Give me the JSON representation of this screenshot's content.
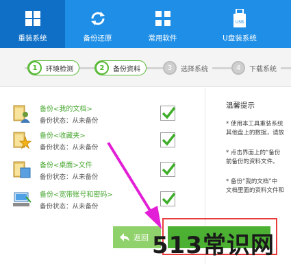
{
  "nav": {
    "items": [
      {
        "label": "重装系统",
        "icon": "windows-icon",
        "active": true
      },
      {
        "label": "备份还原",
        "icon": "refresh-icon",
        "active": false
      },
      {
        "label": "常用软件",
        "icon": "apps-icon",
        "active": false
      },
      {
        "label": "U盘装系统",
        "icon": "usb-icon",
        "active": false
      }
    ],
    "usb_text": "USB"
  },
  "steps": [
    {
      "num": "1",
      "label": "环境检测",
      "state": "done"
    },
    {
      "num": "2",
      "label": "备份资料",
      "state": "done"
    },
    {
      "num": "3",
      "label": "选择系统",
      "state": "pending"
    },
    {
      "num": "4",
      "label": "下载系统",
      "state": "pending"
    }
  ],
  "backup_items": [
    {
      "title": "备份<我的文档>",
      "status": "备份状态：从未备份",
      "icon": "user-folder-icon",
      "checked": true
    },
    {
      "title": "备份<收藏夹>",
      "status": "备份状态：从未备份",
      "icon": "star-folder-icon",
      "checked": true
    },
    {
      "title": "备份<桌面>文件",
      "status": "备份状态：从未备份",
      "icon": "desktop-folder-icon",
      "checked": true
    },
    {
      "title": "备份<宽带账号和密码>",
      "status": "备份状态：从未备份",
      "icon": "network-icon",
      "checked": true
    }
  ],
  "tips": {
    "heading": "温馨提示",
    "items": [
      [
        "* 使用本工具重装系统",
        "其他盘上的数据，请放"
      ],
      [
        "* 点击界面上的“备份",
        "前备份的资料文件。"
      ],
      [
        "* 备份“我的文档”中",
        "文档里面的资料文件和"
      ]
    ]
  },
  "buttons": {
    "back": "返回"
  },
  "watermark": "513常识网",
  "colors": {
    "nav_bg": "#1f8ee6",
    "nav_active": "#0f6fc6",
    "accent_green": "#4cb133",
    "check_green": "#3fae2a",
    "highlight_red": "#e83c3c",
    "arrow_magenta": "#e21fd6"
  }
}
